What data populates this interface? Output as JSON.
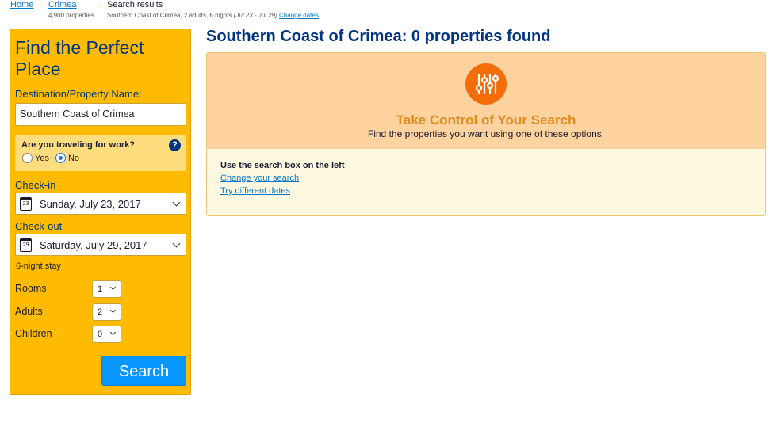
{
  "breadcrumb": {
    "home": "Home",
    "region": "Crimea",
    "region_count": "4,900 properties",
    "current": "Search results",
    "details": "Southern Coast of Crimea, 2 adults, 6 nights",
    "dates": "(Jul 23 - Jul 29)",
    "change_dates": "Change dates",
    "separator": "→"
  },
  "sidebar": {
    "title": "Find the Perfect Place",
    "destination_label": "Destination/Property Name:",
    "destination_value": "Southern Coast of Crimea",
    "work_question": "Are you traveling for work?",
    "work_help": "?",
    "work_yes": "Yes",
    "work_no": "No",
    "work_selected": "No",
    "checkin_label": "Check-in",
    "checkin_value": "Sunday, July 23, 2017",
    "checkin_day": "23",
    "checkout_label": "Check-out",
    "checkout_value": "Saturday, July 29, 2017",
    "checkout_day": "29",
    "stay": "6-night stay",
    "rooms_label": "Rooms",
    "rooms_value": "1",
    "adults_label": "Adults",
    "adults_value": "2",
    "children_label": "Children",
    "children_value": "0",
    "search_button": "Search"
  },
  "main": {
    "title": "Southern Coast of Crimea: 0 properties found",
    "panel_icon": "sliders-icon",
    "panel_heading": "Take Control of Your Search",
    "panel_sub": "Find the properties you want using one of these options:",
    "option_1": "Use the search box on the left",
    "option_2": "Change your search",
    "option_3": "Try different dates"
  },
  "colors": {
    "sidebar_bg": "#febb02",
    "primary": "#003580",
    "accent_orange": "#f46d0b",
    "button_blue": "#0896ff",
    "link": "#0077cc"
  }
}
